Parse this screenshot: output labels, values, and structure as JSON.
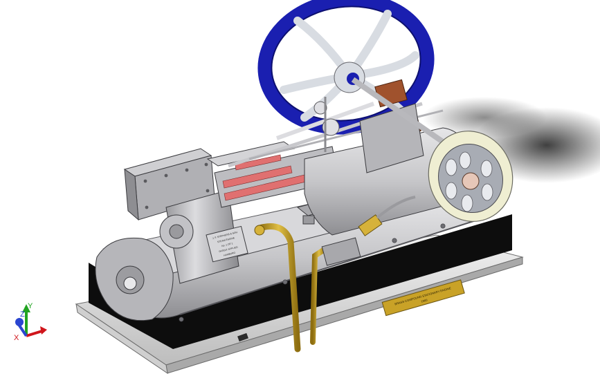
{
  "viewport": {
    "background": "#ffffff"
  },
  "model": {
    "name_plate": {
      "line1": "BRASS COMPOUND STATIONARY ENGINE",
      "line2": "1900"
    },
    "id_plate_lines": [
      "J. F. STEPHENS & SON",
      "STEAM ENGINE",
      "No. 1 OF 1",
      "PATENT APPLIED",
      "HAMBURG"
    ],
    "colors": {
      "flywheel_rim": "#1a1fb0",
      "flywheel_spokes": "#d8dce2",
      "small_wheel_rim": "#efeed2",
      "brass_pipe": "#c9a227",
      "copper": "#a0522d",
      "steel": "#bfbfc2",
      "base_black": "#0d0d0d",
      "piston_red": "#e07070"
    }
  },
  "triad": {
    "x_label": "X",
    "y_label": "Y",
    "z_label": "Z",
    "x_color": "#d0151b",
    "y_color": "#21a421",
    "z_color": "#2a45d0"
  }
}
